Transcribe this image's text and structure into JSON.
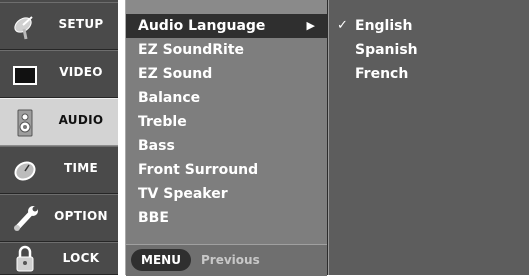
{
  "categories": [
    {
      "label": "SETUP",
      "icon": "satellite-dish-icon",
      "active": false
    },
    {
      "label": "VIDEO",
      "icon": "tv-screen-icon",
      "active": false
    },
    {
      "label": "AUDIO",
      "icon": "speaker-icon",
      "active": true
    },
    {
      "label": "TIME",
      "icon": "clock-icon",
      "active": false
    },
    {
      "label": "OPTION",
      "icon": "wrench-icon",
      "active": false
    },
    {
      "label": "LOCK",
      "icon": "padlock-icon",
      "active": false
    }
  ],
  "menu": {
    "items": [
      {
        "label": "Audio Language",
        "selected": true
      },
      {
        "label": "EZ SoundRite",
        "selected": false
      },
      {
        "label": "EZ Sound",
        "selected": false
      },
      {
        "label": "Balance",
        "selected": false
      },
      {
        "label": "Treble",
        "selected": false
      },
      {
        "label": "Bass",
        "selected": false
      },
      {
        "label": "Front Surround",
        "selected": false
      },
      {
        "label": "TV Speaker",
        "selected": false
      },
      {
        "label": "BBE",
        "selected": false
      }
    ],
    "submenu_arrow": "▶",
    "footer": {
      "key_label": "MENU",
      "key_action": "Previous"
    }
  },
  "submenu": {
    "check_mark": "✓",
    "options": [
      {
        "label": "English",
        "checked": true
      },
      {
        "label": "Spanish",
        "checked": false
      },
      {
        "label": "French",
        "checked": false
      }
    ]
  },
  "colors": {
    "rail_bg": "#4a4a4a",
    "rail_active_bg": "#d3d3d3",
    "menu_bg": "#7e7e7e",
    "menu_selected_bg": "#2f2f2f",
    "submenu_bg": "#5d5d5d"
  }
}
